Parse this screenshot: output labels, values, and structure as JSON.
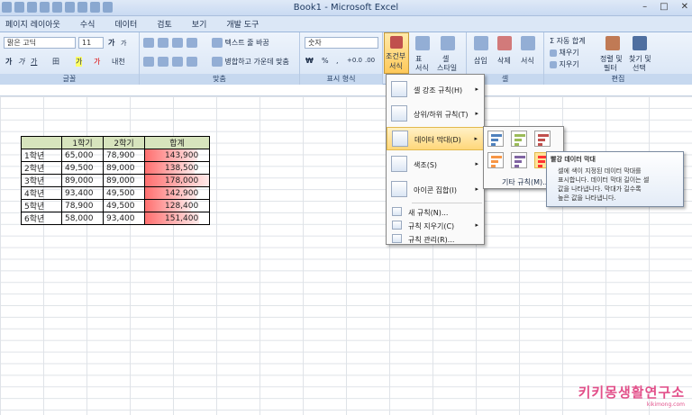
{
  "window": {
    "title": "Book1 - Microsoft Excel",
    "controls": [
      "–",
      "□",
      "✕"
    ]
  },
  "tabs": [
    "페이지 레이아웃",
    "수식",
    "데이터",
    "검토",
    "보기",
    "개발 도구"
  ],
  "ribbon": {
    "font_name": "맑은 고딕",
    "font_size": "11",
    "font_grow": "가",
    "font_shrink": "가",
    "font_styles": [
      "가",
      "가",
      "가"
    ],
    "border_label": "田",
    "fill_label": "가",
    "phonetic_label": "내천",
    "wrap_text": "텍스트 줄 바꿈",
    "merge_center": "병합하고 가운데 맞춤",
    "number_format": "숫자",
    "currency": "₩",
    "percent": "%",
    "comma": ",",
    "inc_decimal": "+0.0",
    "dec_decimal": ".00",
    "cond_format_line1": "조건부",
    "cond_format_line2": "서식",
    "table_format_line1": "표",
    "table_format_line2": "서식",
    "cell_style_line1": "셀",
    "cell_style_line2": "스타일",
    "insert": "삽입",
    "delete": "삭제",
    "format": "서식",
    "autosum": "Σ 자동 합계",
    "fill": "채우기",
    "clear": "지우기",
    "sort_line1": "정렬 및",
    "sort_line2": "필터",
    "find_line1": "찾기 및",
    "find_line2": "선택",
    "group_font": "글꼴",
    "group_align": "맞춤",
    "group_number": "표시 형식",
    "group_cells": "셀",
    "group_edit": "편집"
  },
  "table": {
    "headers": [
      "",
      "1학기",
      "2학기",
      "합계"
    ],
    "rows": [
      {
        "label": "1학년",
        "s1": "65,000",
        "s2": "78,900",
        "total": "143,900",
        "bar": 0.81
      },
      {
        "label": "2학년",
        "s1": "49,500",
        "s2": "89,000",
        "total": "138,500",
        "bar": 0.78
      },
      {
        "label": "3학년",
        "s1": "89,000",
        "s2": "89,000",
        "total": "178,000",
        "bar": 1.0
      },
      {
        "label": "4학년",
        "s1": "93,400",
        "s2": "49,500",
        "total": "142,900",
        "bar": 0.8
      },
      {
        "label": "5학년",
        "s1": "78,900",
        "s2": "49,500",
        "total": "128,400",
        "bar": 0.72
      },
      {
        "label": "6학년",
        "s1": "58,000",
        "s2": "93,400",
        "total": "151,400",
        "bar": 0.85
      }
    ],
    "bar_color": "#ff6f6f"
  },
  "menu": {
    "items": [
      {
        "label": "셀 강조 규칙(H)",
        "has_sub": true
      },
      {
        "label": "상위/하위 규칙(T)",
        "has_sub": true
      },
      {
        "label": "데이터 막대(D)",
        "has_sub": true
      },
      {
        "label": "색조(S)",
        "has_sub": true
      },
      {
        "label": "아이콘 집합(I)",
        "has_sub": true
      }
    ],
    "small_items": [
      {
        "label": "새 규칙(N)...",
        "has_sub": false
      },
      {
        "label": "규칙 지우기(C)",
        "has_sub": true
      },
      {
        "label": "규칙 관리(R)...",
        "has_sub": false
      }
    ],
    "arrow": "▸"
  },
  "submenu": {
    "more_rules": "기타 규칙(M)...",
    "bar_colors": [
      "#4f81bd",
      "#9bbb59",
      "#c0504d",
      "#f79646",
      "#8064a2",
      "#ff3333"
    ]
  },
  "tooltip": {
    "title": "빨강 데이터 막대",
    "body_line1": "셀에 색이 지정된 데이터 막대를",
    "body_line2": "표시합니다. 데이터 막대 길이는 셀",
    "body_line3": "값을 나타냅니다. 막대가 길수록",
    "body_line4": "높은 값을 나타냅니다."
  },
  "watermark": {
    "brand": "키키몽생활연구소",
    "url": "kikimong.com"
  }
}
